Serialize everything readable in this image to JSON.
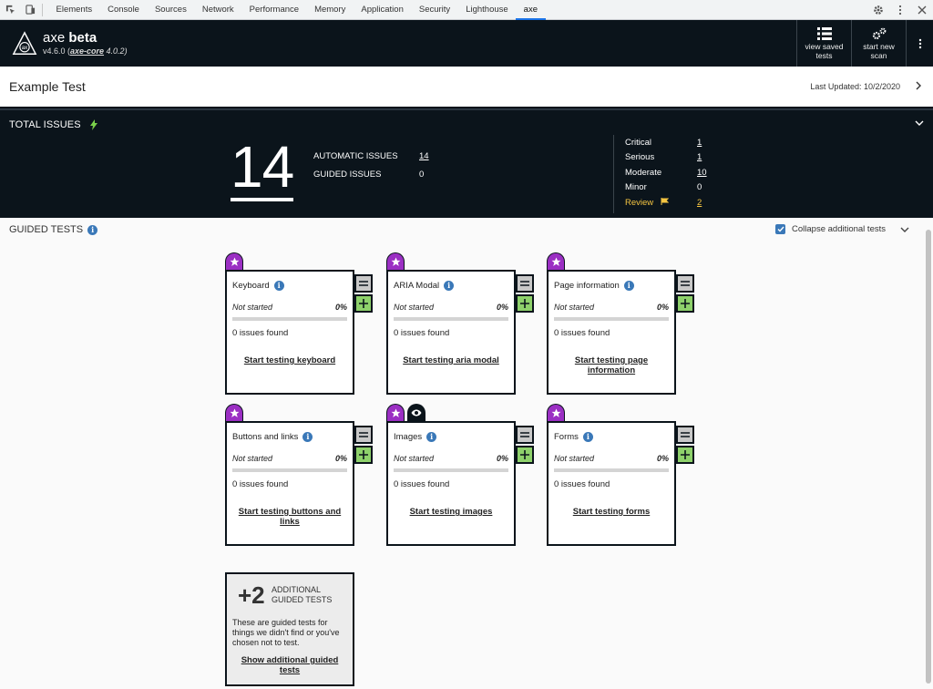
{
  "devtools": {
    "tabs": [
      "Elements",
      "Console",
      "Sources",
      "Network",
      "Performance",
      "Memory",
      "Application",
      "Security",
      "Lighthouse",
      "axe"
    ],
    "active_tab": "axe"
  },
  "header": {
    "brand": "axe",
    "brand_suffix": "beta",
    "version_prefix": "v4.6.0 (",
    "core_name": "axe-core",
    "core_version": " 4.0.2)",
    "view_saved_label": "view saved tests",
    "start_new_label": "start new scan"
  },
  "page": {
    "title": "Example Test",
    "last_updated": "Last Updated: 10/2/2020"
  },
  "total_issues": {
    "label": "TOTAL ISSUES",
    "count": "14",
    "automatic_label": "AUTOMATIC ISSUES",
    "automatic_value": "14",
    "guided_label": "GUIDED ISSUES",
    "guided_value": "0",
    "severity": {
      "critical_label": "Critical",
      "critical_value": "1",
      "serious_label": "Serious",
      "serious_value": "1",
      "moderate_label": "Moderate",
      "moderate_value": "10",
      "minor_label": "Minor",
      "minor_value": "0",
      "review_label": "Review",
      "review_value": "2"
    }
  },
  "guided_tests": {
    "label": "GUIDED TESTS",
    "collapse_label": "Collapse additional tests",
    "cards": [
      {
        "title": "Keyboard",
        "status": "Not started",
        "progress": "0%",
        "found": "0 issues found",
        "link": "Start testing keyboard"
      },
      {
        "title": "ARIA Modal",
        "status": "Not started",
        "progress": "0%",
        "found": "0 issues found",
        "link": "Start testing aria modal"
      },
      {
        "title": "Page information",
        "status": "Not started",
        "progress": "0%",
        "found": "0 issues found",
        "link": "Start testing page information"
      },
      {
        "title": "Buttons and links",
        "status": "Not started",
        "progress": "0%",
        "found": "0 issues found",
        "link": "Start testing buttons and links"
      },
      {
        "title": "Images",
        "status": "Not started",
        "progress": "0%",
        "found": "0 issues found",
        "link": "Start testing images"
      },
      {
        "title": "Forms",
        "status": "Not started",
        "progress": "0%",
        "found": "0 issues found",
        "link": "Start testing forms"
      }
    ],
    "additional": {
      "count": "+2",
      "label": "ADDITIONAL GUIDED TESTS",
      "description": "These are guided tests for things we didn't find or you've chosen not to test.",
      "link": "Show additional guided tests"
    }
  }
}
